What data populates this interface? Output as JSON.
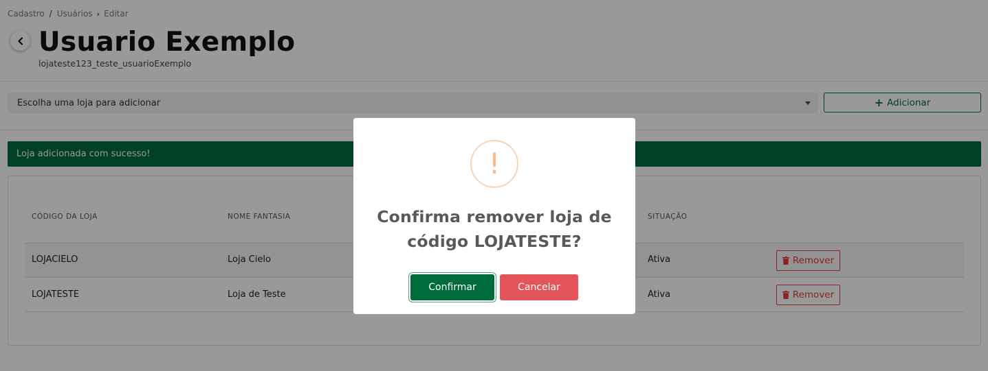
{
  "breadcrumb": {
    "items": [
      "Cadastro",
      "Usuários",
      "Editar"
    ],
    "sep1": "/",
    "sep2": "›"
  },
  "header": {
    "title": "Usuario Exemplo",
    "subtitle": "lojateste123_teste_usuarioExemplo"
  },
  "store_select": {
    "placeholder": "Escolha uma loja para adicionar"
  },
  "add_button": {
    "label": "Adicionar",
    "icon": "plus-icon"
  },
  "alert": {
    "message": "Loja adicionada com sucesso!",
    "color": "#006c3c"
  },
  "table": {
    "columns": [
      "CÓDIGO DA LOJA",
      "NOME FANTASIA",
      "SITUAÇÃO"
    ],
    "rows": [
      {
        "code": "LOJACIELO",
        "name": "Loja Cielo",
        "status": "Ativa",
        "action": "Remover"
      },
      {
        "code": "LOJATESTE",
        "name": "Loja de Teste",
        "status": "Ativa",
        "action": "Remover"
      }
    ]
  },
  "modal": {
    "icon": "warning-icon",
    "icon_glyph": "!",
    "title_line1": "Confirma remover loja de",
    "title_line2": "código LOJATESTE?",
    "confirm_label": "Confirmar",
    "cancel_label": "Cancelar",
    "confirm_color": "#006c3c",
    "cancel_color": "#e5545a"
  }
}
